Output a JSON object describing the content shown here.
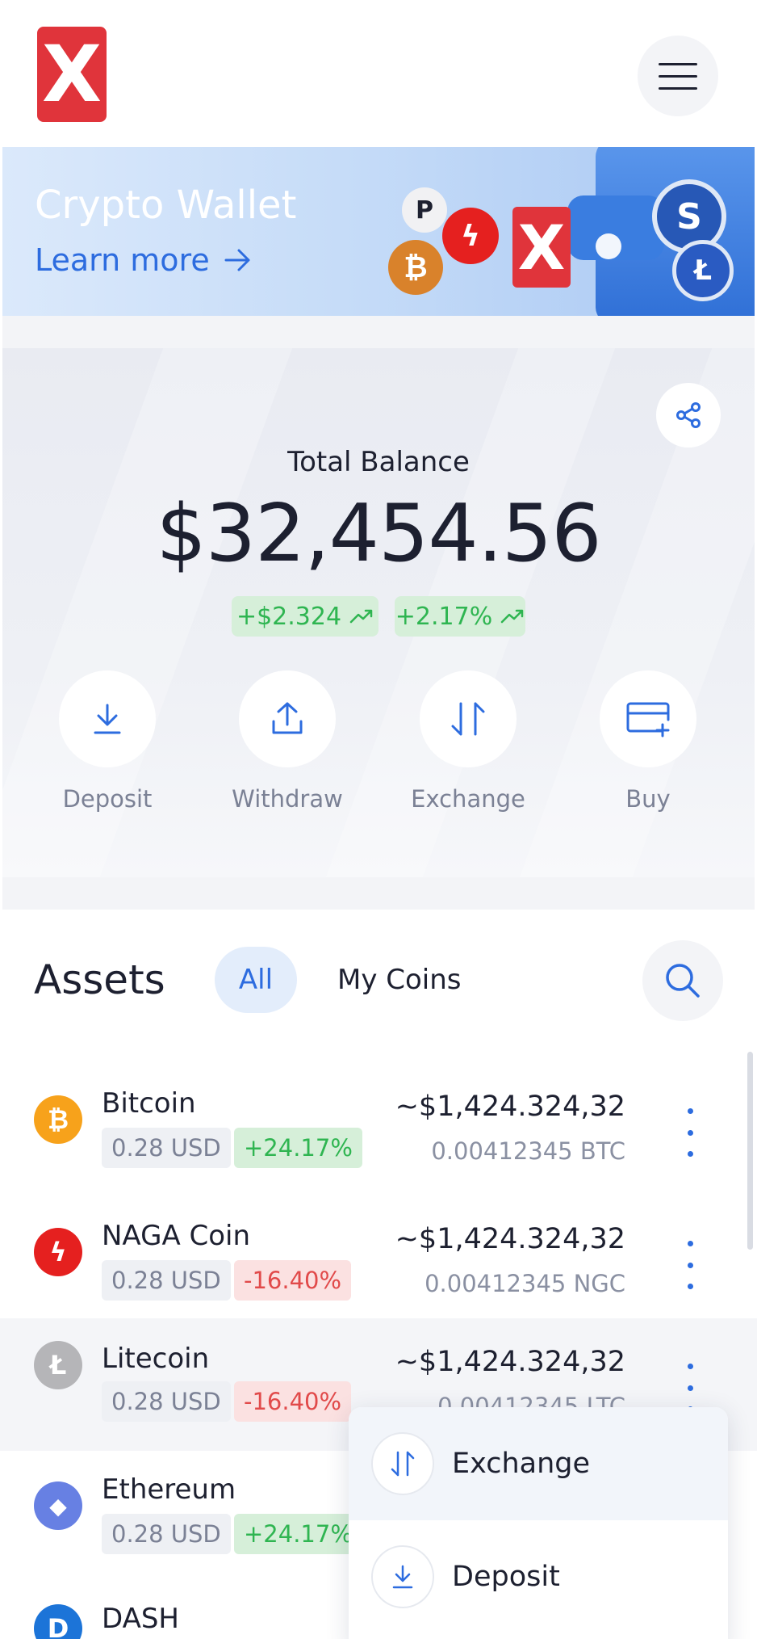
{
  "header": {
    "logo_text": "X",
    "menu_icon": "hamburger-icon"
  },
  "banner": {
    "title": "Crypto Wallet",
    "link_label": "Learn more",
    "wallet_logo": "X"
  },
  "balance": {
    "label": "Total Balance",
    "value": "$32,454.56",
    "change_amount": "+$2.324",
    "change_percent": "+2.17%"
  },
  "actions": [
    {
      "label": "Deposit",
      "icon": "download-icon"
    },
    {
      "label": "Withdraw",
      "icon": "upload-icon"
    },
    {
      "label": "Exchange",
      "icon": "swap-icon"
    },
    {
      "label": "Buy",
      "icon": "card-add-icon"
    }
  ],
  "assets": {
    "title": "Assets",
    "tabs": [
      {
        "label": "All",
        "selected": true
      },
      {
        "label": "My Coins",
        "selected": false
      }
    ],
    "rows": [
      {
        "name": "Bitcoin",
        "symbol_glyph": "₿",
        "color": "#f7a21b",
        "price": "0.28 USD",
        "change": "+24.17%",
        "trend": "up",
        "value": "~$1,424.324,32",
        "amount": "0.00412345 BTC"
      },
      {
        "name": "NAGA Coin",
        "symbol_glyph": "ϟ",
        "color": "#e5201f",
        "price": "0.28 USD",
        "change": "-16.40%",
        "trend": "down",
        "value": "~$1,424.324,32",
        "amount": "0.00412345 NGC"
      },
      {
        "name": "Litecoin",
        "symbol_glyph": "Ł",
        "color": "#b5b5b8",
        "price": "0.28 USD",
        "change": "-16.40%",
        "trend": "down",
        "value": "~$1,424.324,32",
        "amount": "0.00412345 LTC"
      },
      {
        "name": "Ethereum",
        "symbol_glyph": "◆",
        "color": "#6780e3",
        "price": "0.28 USD",
        "change": "+24.17%",
        "trend": "up",
        "value": "",
        "amount": ""
      },
      {
        "name": "DASH",
        "symbol_glyph": "D",
        "color": "#1c74d8",
        "price": "",
        "change": "",
        "trend": "",
        "value": "",
        "amount": ""
      }
    ]
  },
  "dropdown": {
    "items": [
      {
        "label": "Exchange",
        "icon": "swap-icon",
        "active": true
      },
      {
        "label": "Deposit",
        "icon": "download-icon",
        "active": false
      }
    ]
  },
  "colors": {
    "accent": "#2d6cdf",
    "positive": "#2fb551",
    "negative": "#e14a4a",
    "brand": "#e0343b"
  }
}
